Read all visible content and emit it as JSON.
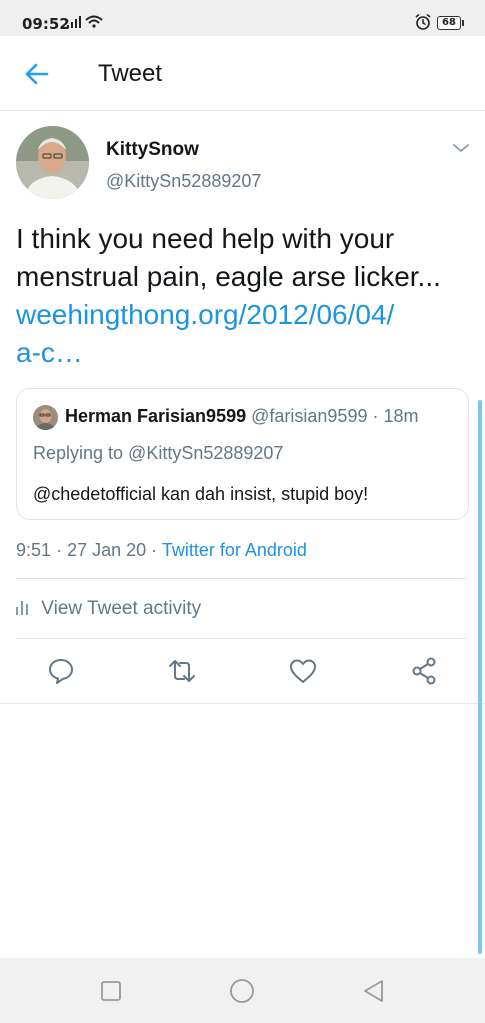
{
  "status_bar": {
    "time": "09:52",
    "signal": ".ıl",
    "battery": "68"
  },
  "header": {
    "title": "Tweet"
  },
  "tweet": {
    "author_name": "KittySnow",
    "author_handle": "@KittySn52889207",
    "text": "I think you need help with your menstrual pain, eagle arse licker...",
    "link_line1": "weehingthong.org/2012/06/04/",
    "link_line2": "a-c…",
    "time": "9:51",
    "date": "27 Jan 20",
    "separator": "·",
    "source": "Twitter for Android"
  },
  "quote": {
    "author_name": "Herman Farisian9599",
    "author_handle": "@farisian9599",
    "age": "· 18m",
    "replying_to": "Replying to @KittySn52889207",
    "text": "@chedetofficial kan dah insist, stupid boy!"
  },
  "activity": {
    "label": "View Tweet activity"
  },
  "actions": {
    "icons": [
      "reply-icon",
      "retweet-icon",
      "like-icon",
      "share-icon"
    ]
  },
  "colors": {
    "accent": "#1b95e0",
    "secondary_text": "#657786",
    "divider": "#e1e8ed"
  }
}
